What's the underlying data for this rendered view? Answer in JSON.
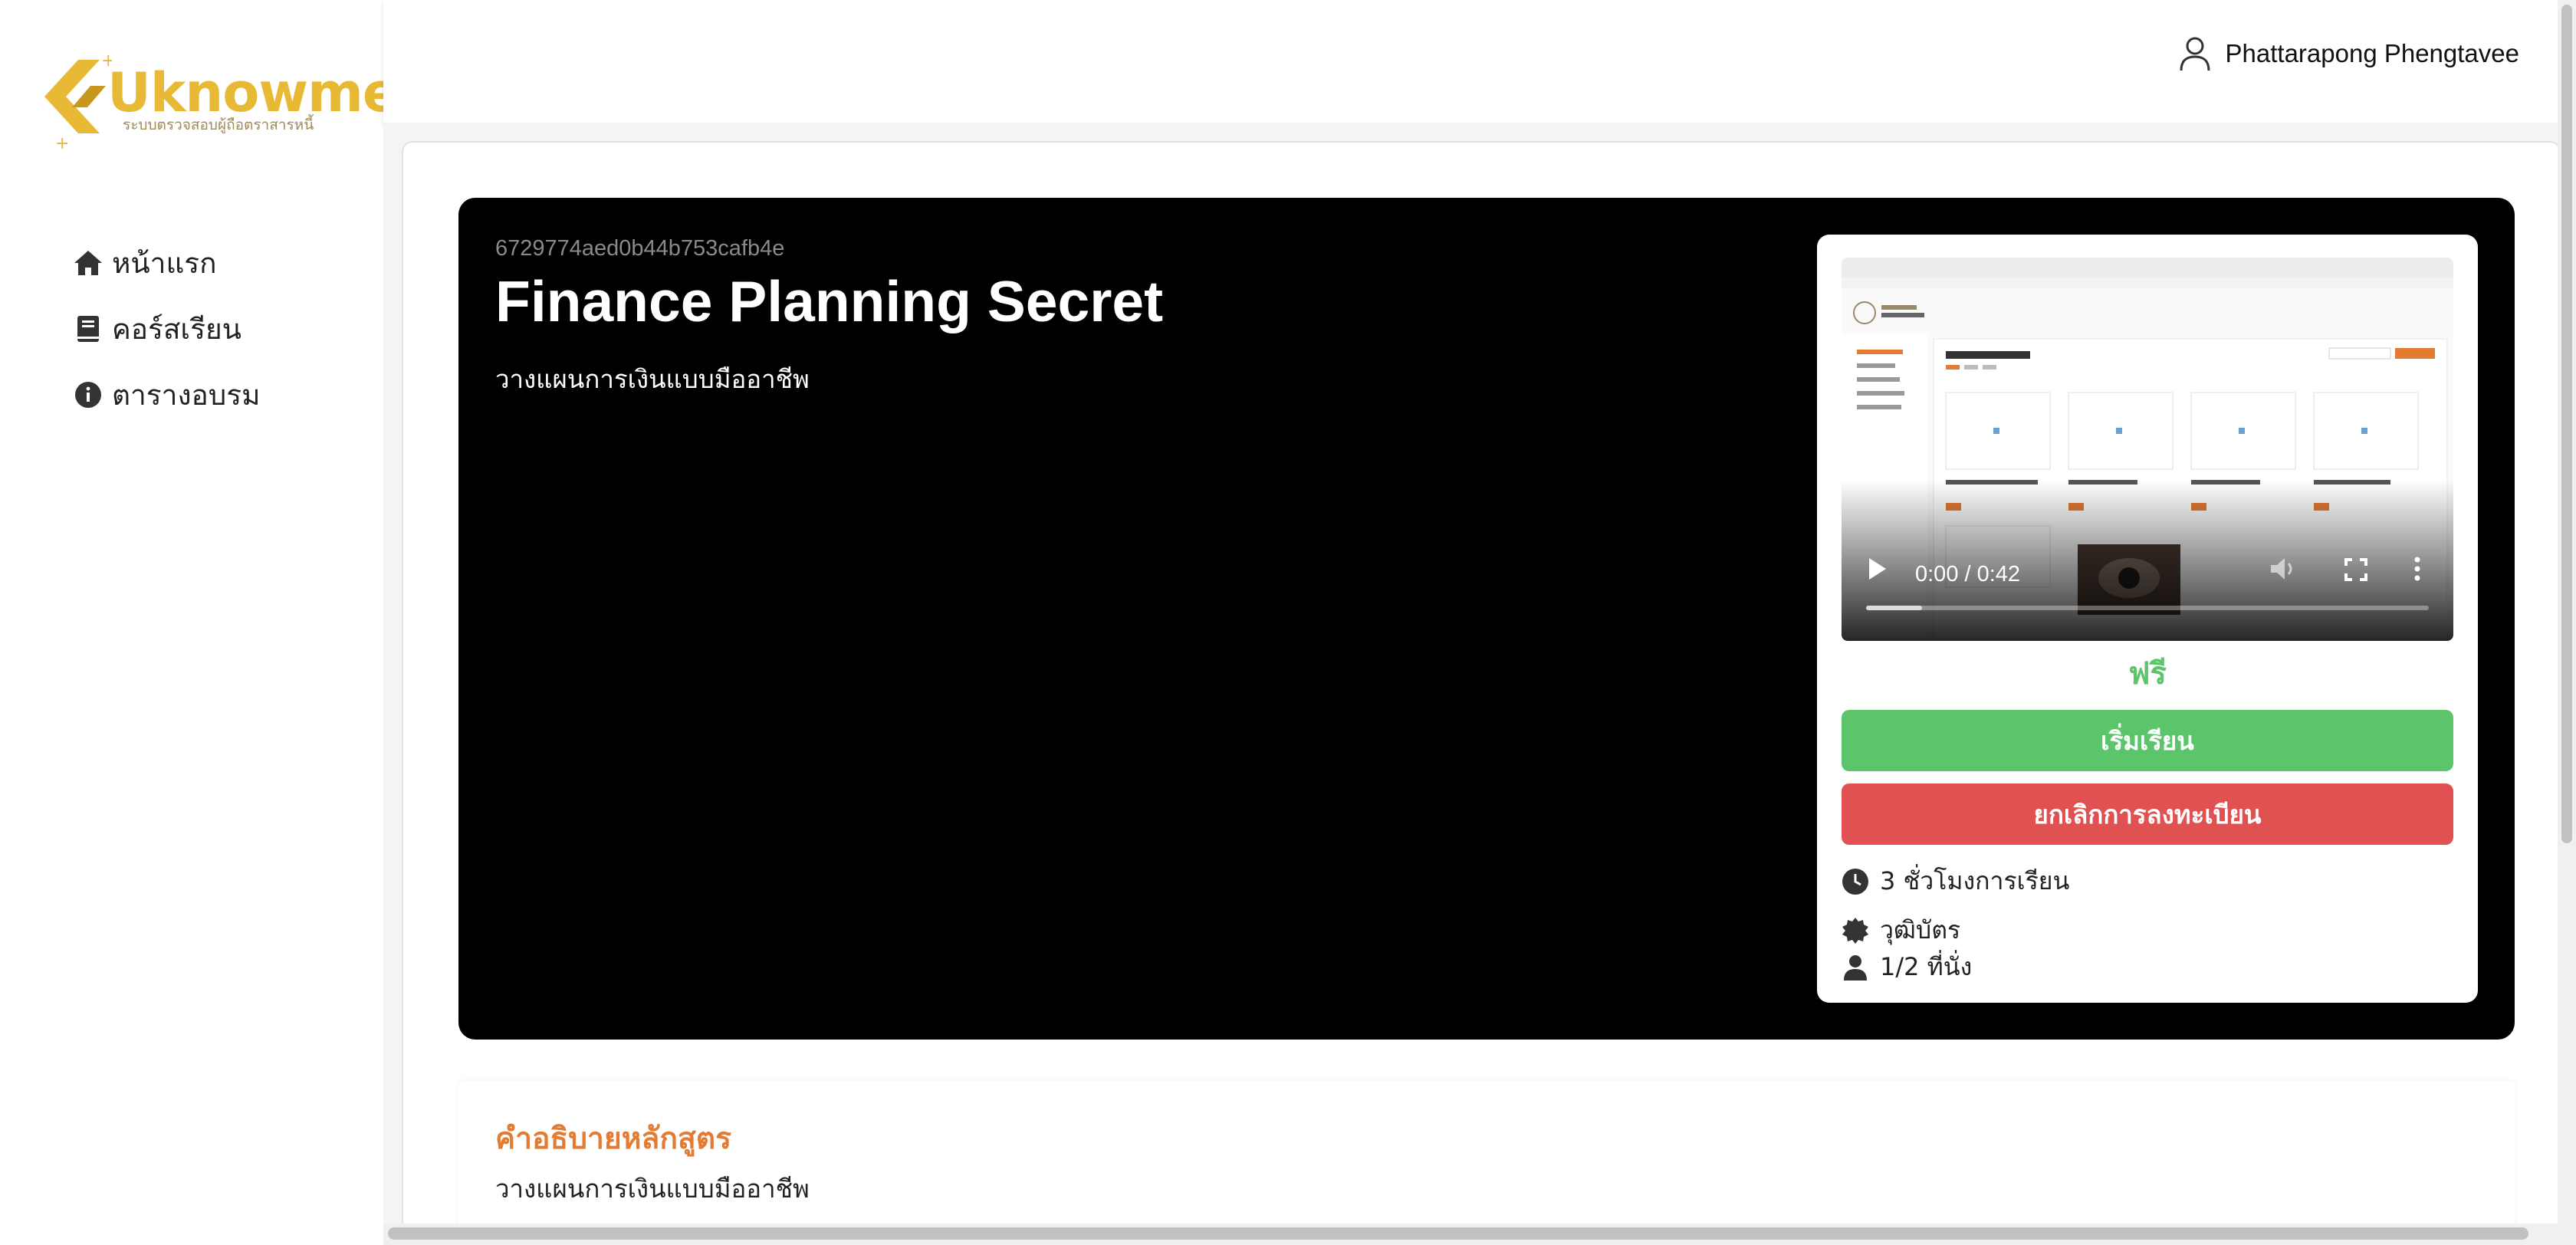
{
  "app": {
    "logo_text": "Uknowme",
    "logo_subtitle": "ระบบตรวจสอบผู้ถือตราสารหนี้"
  },
  "sidebar": {
    "items": [
      {
        "label": "หน้าแรก",
        "icon": "home-icon"
      },
      {
        "label": "คอร์สเรียน",
        "icon": "book-icon"
      },
      {
        "label": "ตารางอบรม",
        "icon": "info-icon"
      }
    ]
  },
  "header": {
    "user_name": "Phattarapong Phengtavee",
    "user_icon": "user-icon"
  },
  "course": {
    "id": "6729774aed0b44b753cafb4e",
    "title": "Finance Planning Secret",
    "subtitle": "วางแผนการเงินแบบมืออาชีพ",
    "video": {
      "time": "0:00 / 0:42",
      "progress": 0.1
    },
    "price": "ฟรี",
    "start_button": "เริ่มเรียน",
    "cancel_button": "ยกเลิกการลงทะเบียน",
    "hours": "3 ชั่วโมงการเรียน",
    "certificate": "วุฒิบัตร",
    "seats": "1/2 ที่นั่ง"
  },
  "description": {
    "heading": "คำอธิบายหลักสูตร",
    "text": "วางแผนการเงินแบบมืออาชีพ"
  },
  "colors": {
    "accent_orange": "#e47b32",
    "logo_yellow": "#e8b935",
    "success_green": "#5cc46b",
    "danger_red": "#e05252"
  }
}
